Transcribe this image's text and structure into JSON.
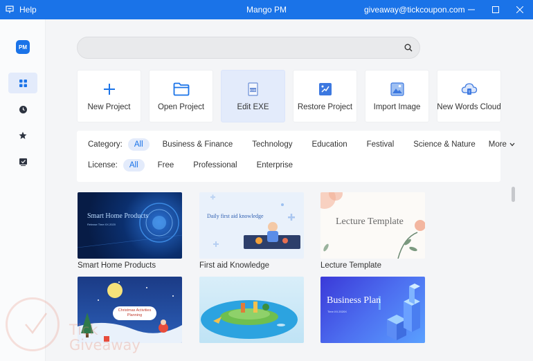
{
  "titlebar": {
    "help_label": "Help",
    "app_title": "Mango PM",
    "user_email": "giveaway@tickcoupon.com"
  },
  "sidebar": {
    "logo_text": "PM",
    "items": [
      {
        "name": "templates",
        "icon": "grid-icon",
        "active": true
      },
      {
        "name": "recent",
        "icon": "clock-icon",
        "active": false
      },
      {
        "name": "favorites",
        "icon": "star-icon",
        "active": false
      },
      {
        "name": "tasks",
        "icon": "task-check-icon",
        "active": false
      }
    ]
  },
  "search": {
    "placeholder": "",
    "value": ""
  },
  "actions": [
    {
      "label": "New Project",
      "icon": "plus-icon"
    },
    {
      "label": "Open Project",
      "icon": "folder-icon"
    },
    {
      "label": "Edit EXE",
      "icon": "exe-file-icon",
      "highlighted": true
    },
    {
      "label": "Restore Project",
      "icon": "restore-icon"
    },
    {
      "label": "Import Image",
      "icon": "image-icon"
    },
    {
      "label": "New Words Cloud",
      "icon": "words-cloud-icon"
    }
  ],
  "filters": {
    "category_label": "Category:",
    "categories": [
      "All",
      "Business & Finance",
      "Technology",
      "Education",
      "Festival",
      "Science & Nature"
    ],
    "more_label": "More",
    "license_label": "License:",
    "licenses": [
      "All",
      "Free",
      "Professional",
      "Enterprise"
    ],
    "active_category": "All",
    "active_license": "All"
  },
  "templates": [
    {
      "name": "Smart Home Products",
      "thumb_title": "Smart Home Products",
      "thumb_sub": "Release Time:XX.2020"
    },
    {
      "name": "First aid Knowledge",
      "thumb_title": "Daily first aid knowledge"
    },
    {
      "name": "Lecture Template",
      "thumb_title": "Lecture Template"
    },
    {
      "name": "",
      "thumb_title": "Christmas Activities Planning"
    },
    {
      "name": "",
      "thumb_title": ""
    },
    {
      "name": "",
      "thumb_title": "Business Plan",
      "thumb_sub": "Time:XX.2020X"
    }
  ],
  "watermark": {
    "line1": "Tick",
    "line2": "Giveaway"
  },
  "colors": {
    "accent": "#1a73e8",
    "highlight": "#e3ebfb",
    "background": "#f4f5f7"
  }
}
